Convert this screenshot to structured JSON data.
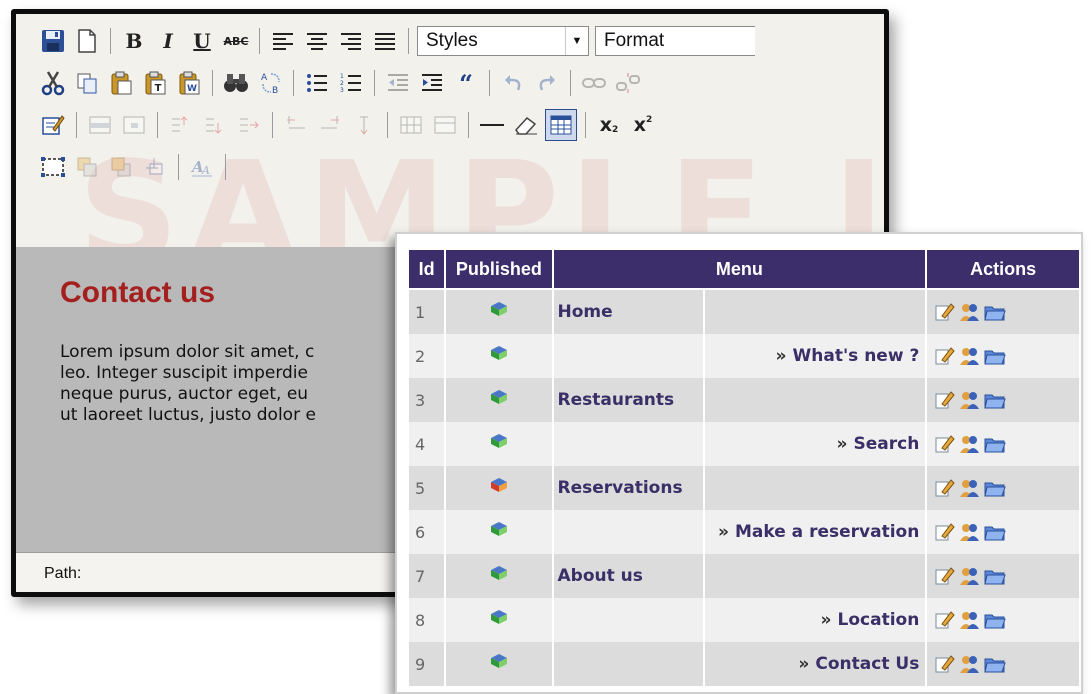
{
  "editor": {
    "toolbar": {
      "bold": "B",
      "italic": "I",
      "underline": "U",
      "strike": "ABC",
      "styles": "Styles",
      "format": "Format",
      "subscript": "x",
      "superscript": "x"
    },
    "content": {
      "title": "Contact us",
      "lines": [
        "Lorem ipsum dolor sit amet, c",
        "leo. Integer suscipit imperdie",
        "neque purus, auctor eget, eu",
        "ut laoreet luctus, justo dolor e"
      ]
    },
    "status": {
      "path_label": "Path:"
    },
    "watermark": "SAMPLE IMAGE"
  },
  "menu_table": {
    "headers": [
      "Id",
      "Published",
      "Menu",
      "Actions"
    ],
    "rows": [
      {
        "id": "1",
        "parent": "Home",
        "child": "",
        "published": "green"
      },
      {
        "id": "2",
        "parent": "",
        "child": "What's new ?",
        "published": "green"
      },
      {
        "id": "3",
        "parent": "Restaurants",
        "child": "",
        "published": "green"
      },
      {
        "id": "4",
        "parent": "",
        "child": "Search",
        "published": "green"
      },
      {
        "id": "5",
        "parent": "Reservations",
        "child": "",
        "published": "red"
      },
      {
        "id": "6",
        "parent": "",
        "child": "Make a reservation",
        "published": "green"
      },
      {
        "id": "7",
        "parent": "About us",
        "child": "",
        "published": "green"
      },
      {
        "id": "8",
        "parent": "",
        "child": "Location",
        "published": "green"
      },
      {
        "id": "9",
        "parent": "",
        "child": "Contact Us",
        "published": "green"
      }
    ],
    "child_marker": "»"
  },
  "colors": {
    "header_bg": "#3c2d6b",
    "title_red": "#a3201f",
    "menu_text": "#3a2f66"
  }
}
